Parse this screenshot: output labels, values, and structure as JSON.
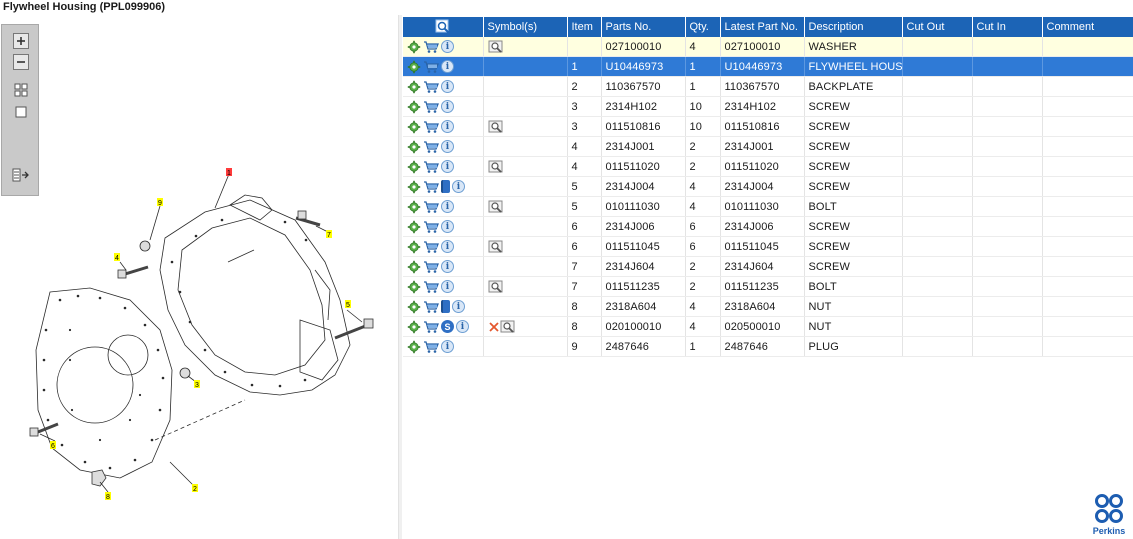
{
  "window": {
    "title": "Flywheel Housing (PPL099906)"
  },
  "toolbar": {
    "zoom_in": "zoom-in-icon",
    "zoom_out": "zoom-out-icon",
    "fit_all": "fit-all-icon",
    "actual_size": "actual-size-icon",
    "toggle_list": "toggle-list-icon"
  },
  "diagram": {
    "callouts": [
      "1",
      "2",
      "3",
      "4",
      "5",
      "6",
      "7",
      "8",
      "9"
    ]
  },
  "grid": {
    "columns": [
      "",
      "Symbol(s)",
      "Item",
      "Parts No.",
      "Qty.",
      "Latest Part No.",
      "Description",
      "Cut Out",
      "Cut In",
      "Comment"
    ],
    "rows": [
      {
        "symbol": "magnifier",
        "item": "",
        "part": "027100010",
        "qty": "4",
        "latest": "027100010",
        "desc": "WASHER",
        "extra": "none",
        "state": "highlight"
      },
      {
        "symbol": "",
        "item": "1",
        "part": "U10446973",
        "qty": "1",
        "latest": "U10446973",
        "desc": "FLYWHEEL HOUSIN",
        "extra": "none",
        "state": "selected"
      },
      {
        "symbol": "",
        "item": "2",
        "part": "110367570",
        "qty": "1",
        "latest": "110367570",
        "desc": "BACKPLATE",
        "extra": "none",
        "state": ""
      },
      {
        "symbol": "",
        "item": "3",
        "part": "2314H102",
        "qty": "10",
        "latest": "2314H102",
        "desc": "SCREW",
        "extra": "none",
        "state": ""
      },
      {
        "symbol": "magnifier",
        "item": "3",
        "part": "011510816",
        "qty": "10",
        "latest": "011510816",
        "desc": "SCREW",
        "extra": "none",
        "state": ""
      },
      {
        "symbol": "",
        "item": "4",
        "part": "2314J001",
        "qty": "2",
        "latest": "2314J001",
        "desc": "SCREW",
        "extra": "none",
        "state": ""
      },
      {
        "symbol": "magnifier",
        "item": "4",
        "part": "011511020",
        "qty": "2",
        "latest": "011511020",
        "desc": "SCREW",
        "extra": "none",
        "state": ""
      },
      {
        "symbol": "",
        "item": "5",
        "part": "2314J004",
        "qty": "4",
        "latest": "2314J004",
        "desc": "SCREW",
        "extra": "book",
        "state": ""
      },
      {
        "symbol": "magnifier",
        "item": "5",
        "part": "010111030",
        "qty": "4",
        "latest": "010111030",
        "desc": "BOLT",
        "extra": "none",
        "state": ""
      },
      {
        "symbol": "",
        "item": "6",
        "part": "2314J006",
        "qty": "6",
        "latest": "2314J006",
        "desc": "SCREW",
        "extra": "none",
        "state": ""
      },
      {
        "symbol": "magnifier",
        "item": "6",
        "part": "011511045",
        "qty": "6",
        "latest": "011511045",
        "desc": "SCREW",
        "extra": "none",
        "state": ""
      },
      {
        "symbol": "",
        "item": "7",
        "part": "2314J604",
        "qty": "2",
        "latest": "2314J604",
        "desc": "SCREW",
        "extra": "none",
        "state": ""
      },
      {
        "symbol": "magnifier",
        "item": "7",
        "part": "011511235",
        "qty": "2",
        "latest": "011511235",
        "desc": "BOLT",
        "extra": "none",
        "state": ""
      },
      {
        "symbol": "",
        "item": "8",
        "part": "2318A604",
        "qty": "4",
        "latest": "2318A604",
        "desc": "NUT",
        "extra": "book",
        "state": ""
      },
      {
        "symbol": "cross-magnifier",
        "item": "8",
        "part": "020100010",
        "qty": "4",
        "latest": "020500010",
        "desc": "NUT",
        "extra": "s",
        "state": ""
      },
      {
        "symbol": "",
        "item": "9",
        "part": "2487646",
        "qty": "1",
        "latest": "2487646",
        "desc": "PLUG",
        "extra": "none",
        "state": ""
      }
    ]
  },
  "brand": {
    "name": "Perkins",
    "color": "#1d5db1"
  },
  "colors": {
    "header": "#1c64b6",
    "selected": "#2f7ad6",
    "highlight": "#ffffe0",
    "callout": "#ffff00"
  }
}
